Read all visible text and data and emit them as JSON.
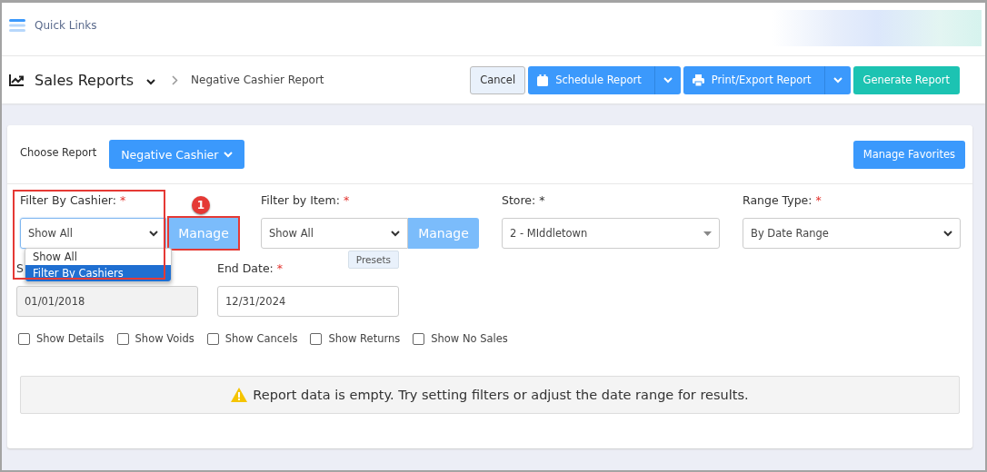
{
  "topbar": {
    "title": "Quick Links"
  },
  "header": {
    "section": "Sales Reports",
    "breadcrumb": "Negative Cashier Report",
    "buttons": [
      {
        "label": "Cancel",
        "kind": "plain"
      },
      {
        "label": "Schedule Report",
        "kind": "split"
      },
      {
        "label": "Print/Export Report",
        "kind": "split"
      },
      {
        "label": "Generate Report",
        "kind": "success"
      }
    ]
  },
  "report": {
    "label": "Choose Report",
    "value": "Negative Cashier",
    "favorites": "Manage Favorites"
  },
  "filters": [
    {
      "label": "Filter By Cashier:",
      "required": true,
      "value": "Show All",
      "manage": "Manage",
      "highlighted": true
    },
    {
      "label": "Filter by Item:",
      "required": true,
      "value": "Show All",
      "manage": "Manage",
      "highlighted": false
    },
    {
      "label": "Store: *",
      "value": "2 - MIddletown"
    },
    {
      "label": "Range Type:",
      "required": true,
      "value": "By Date Range"
    }
  ],
  "required_mark": "*",
  "step_badge": "1",
  "cashier_dropdown": [
    {
      "label": "Show All",
      "selected": false
    },
    {
      "label": "Filter By Cashiers",
      "selected": true
    }
  ],
  "dates": [
    {
      "label": "S",
      "value": "01/01/2018",
      "disabled": true
    },
    {
      "label": "End Date:",
      "required": true,
      "value": "12/31/2024",
      "disabled": false,
      "presets": "Presets"
    }
  ],
  "options": [
    {
      "label": "Show Details",
      "checked": false
    },
    {
      "label": "Show Voids",
      "checked": false
    },
    {
      "label": "Show Cancels",
      "checked": false
    },
    {
      "label": "Show Returns",
      "checked": false
    },
    {
      "label": "Show No Sales",
      "checked": false
    }
  ],
  "alert": "Report data is empty. Try setting filters or adjust the date range for results."
}
